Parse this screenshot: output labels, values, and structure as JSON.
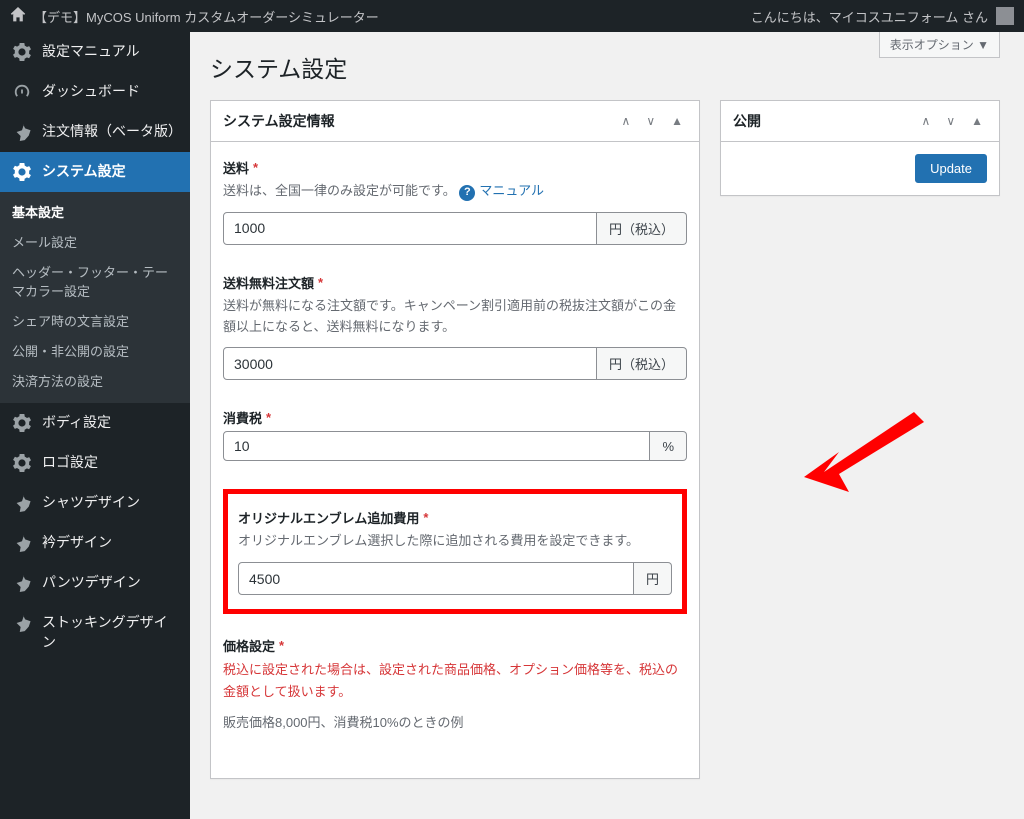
{
  "admin_bar": {
    "site_title": "【デモ】MyCOS Uniform カスタムオーダーシミュレーター",
    "greeting": "こんにちは、マイコスユニフォーム さん"
  },
  "sidebar": {
    "items": [
      {
        "label": "設定マニュアル",
        "icon": "gear"
      },
      {
        "label": "ダッシュボード",
        "icon": "dashboard"
      },
      {
        "label": "注文情報（ベータ版）",
        "icon": "pin"
      },
      {
        "label": "システム設定",
        "icon": "gear",
        "current": true
      },
      {
        "label": "ボディ設定",
        "icon": "gear"
      },
      {
        "label": "ロゴ設定",
        "icon": "gear"
      },
      {
        "label": "シャツデザイン",
        "icon": "pin"
      },
      {
        "label": "衿デザイン",
        "icon": "pin"
      },
      {
        "label": "パンツデザイン",
        "icon": "pin"
      },
      {
        "label": "ストッキングデザイン",
        "icon": "pin"
      }
    ],
    "submenu": [
      {
        "label": "基本設定",
        "current": true
      },
      {
        "label": "メール設定"
      },
      {
        "label": "ヘッダー・フッター・テーマカラー設定"
      },
      {
        "label": "シェア時の文言設定"
      },
      {
        "label": "公開・非公開の設定"
      },
      {
        "label": "決済方法の設定"
      }
    ]
  },
  "screen_options_label": "表示オプション ▼",
  "page_title": "システム設定",
  "main_box": {
    "title": "システム設定情報",
    "fields": {
      "shipping": {
        "label": "送料",
        "desc": "送料は、全国一律のみ設定が可能です。",
        "manual_link": "マニュアル",
        "value": "1000",
        "suffix": "円（税込）"
      },
      "free_shipping": {
        "label": "送料無料注文額",
        "desc": "送料が無料になる注文額です。キャンペーン割引適用前の税抜注文額がこの金額以上になると、送料無料になります。",
        "value": "30000",
        "suffix": "円（税込）"
      },
      "tax": {
        "label": "消費税",
        "value": "10",
        "suffix": "%"
      },
      "emblem": {
        "label": "オリジナルエンブレム追加費用",
        "desc": "オリジナルエンブレム選択した際に追加される費用を設定できます。",
        "value": "4500",
        "suffix": "円"
      },
      "price_setting": {
        "label": "価格設定",
        "warning": "税込に設定された場合は、設定された商品価格、オプション価格等を、税込の金額として扱います。",
        "example": "販売価格8,000円、消費税10%のときの例"
      }
    }
  },
  "publish_box": {
    "title": "公開",
    "button": "Update"
  }
}
